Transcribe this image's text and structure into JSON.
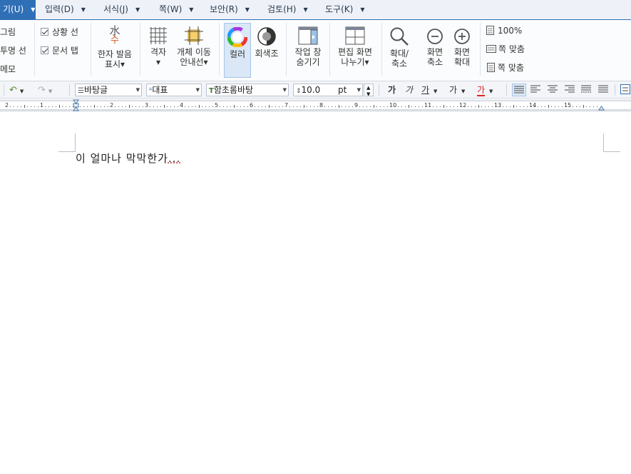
{
  "menu": {
    "items": [
      {
        "label": "기(U)",
        "name": "menu-tools-partial",
        "active": true
      },
      {
        "label": "입력(D)",
        "name": "menu-input"
      },
      {
        "label": "서식(J)",
        "name": "menu-format"
      },
      {
        "label": "쪽(W)",
        "name": "menu-page"
      },
      {
        "label": "보안(R)",
        "name": "menu-security"
      },
      {
        "label": "검토(H)",
        "name": "menu-review"
      },
      {
        "label": "도구(K)",
        "name": "menu-tools"
      }
    ]
  },
  "ribbon": {
    "left_labels": [
      "그림",
      "투명 선",
      "메모"
    ],
    "checks": [
      {
        "label": "상황 선",
        "checked": true
      },
      {
        "label": "문서 탭",
        "checked": true
      }
    ],
    "tools": {
      "hanja": "한자 발음\n표시▾",
      "hanja_glyph_top": "水",
      "hanja_glyph_bottom": "수",
      "grid": "격자\n▾",
      "move_guide": "개체 이동\n안내선▾",
      "color": "컬러",
      "grayscale": "회색조",
      "hide_window": "작업 창\n숨기기",
      "split_screen": "편집 화면\n나누기▾",
      "zoom": "확대/\n축소",
      "zoom_out": "화면\n축소",
      "zoom_in": "화면\n확대"
    },
    "zoom_options": [
      "100%",
      "쪽 맞춤",
      "쪽 맞춤"
    ]
  },
  "formatbar": {
    "style": "바탕글",
    "lang": "대표",
    "font": "함초롬바탕",
    "size": "10.0",
    "unit": "pt",
    "bold": "가",
    "italic": "가",
    "underline": "가",
    "strike": "가",
    "color_text": "가"
  },
  "ruler": {
    "numbers": [
      "2",
      "1",
      "1",
      "2",
      "3",
      "4",
      "5",
      "6",
      "7",
      "8",
      "9",
      "10",
      "11",
      "12",
      "13",
      "14",
      "15"
    ]
  },
  "document": {
    "text_main": "이 얼마나 막막한가",
    "text_tail": "..."
  },
  "colors": {
    "accent": "#2f6fb6",
    "menubar_bg": "#eef2f8"
  }
}
